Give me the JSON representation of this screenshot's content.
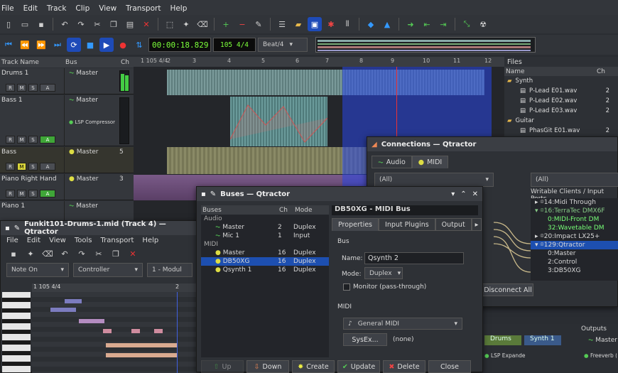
{
  "menu": [
    "File",
    "Edit",
    "Track",
    "Clip",
    "View",
    "Transport",
    "Help"
  ],
  "transport": {
    "time": "00:00:18.829",
    "tempo": "105 4/4",
    "snap": "Beat/4"
  },
  "tracklist": {
    "headers": {
      "name": "Track Name",
      "bus": "Bus",
      "ch": "Ch"
    },
    "tracks": [
      {
        "name": "Drums 1",
        "bus": "Master",
        "ch": ""
      },
      {
        "name": "Bass 1",
        "bus": "Master",
        "ch": "",
        "plugin": "LSP Compressor"
      },
      {
        "name": "Bass",
        "bus": "Master",
        "ch": "5"
      },
      {
        "name": "Piano Right Hand",
        "bus": "Master",
        "ch": "3"
      },
      {
        "name": "Piano 1",
        "bus": "Master",
        "ch": ""
      }
    ],
    "buttons": {
      "r": "R",
      "m": "M",
      "s": "S",
      "a": "A"
    }
  },
  "ruler": {
    "marks": [
      "1 105 4/4",
      "2",
      "3",
      "4",
      "5",
      "6",
      "7",
      "8",
      "9",
      "10",
      "11",
      "12"
    ]
  },
  "files": {
    "title": "Files",
    "headers": {
      "name": "Name",
      "ch": "Ch"
    },
    "items": [
      {
        "name": "Synth",
        "folder": true
      },
      {
        "name": "P-Lead E01.wav",
        "ch": "2"
      },
      {
        "name": "P-Lead E02.wav",
        "ch": "2"
      },
      {
        "name": "P-Lead E03.wav",
        "ch": "2"
      },
      {
        "name": "Guitar",
        "folder": true
      },
      {
        "name": "PhasGit E01.wav",
        "ch": "2"
      }
    ]
  },
  "connections": {
    "title": "Connections — Qtractor",
    "tab_audio": "Audio",
    "tab_midi": "MIDI",
    "filter_left": "(All)",
    "filter_right": "(All)",
    "writable_label": "Writable Clients / Input Ports",
    "clients": [
      {
        "label": "14:Midi Through"
      },
      {
        "label": "16:TerraTec DMX6F"
      },
      {
        "label": "0:MIDI-Front DM"
      },
      {
        "label": "32:Wavetable DM"
      },
      {
        "label": "20:Impact LX25+"
      },
      {
        "label": "129:Qtractor"
      },
      {
        "label": "0:Master"
      },
      {
        "label": "2:Control"
      },
      {
        "label": "3:DB50XG"
      }
    ],
    "disconnect_all": "Disconnect All"
  },
  "buses": {
    "title": "Buses — Qtractor",
    "headers": {
      "buses": "Buses",
      "ch": "Ch",
      "mode": "Mode"
    },
    "groups": [
      {
        "label": "Audio",
        "items": [
          {
            "name": "Master",
            "ch": "2",
            "mode": "Duplex"
          },
          {
            "name": "Mic 1",
            "ch": "1",
            "mode": "Input"
          }
        ]
      },
      {
        "label": "MIDI",
        "items": [
          {
            "name": "Master",
            "ch": "16",
            "mode": "Duplex"
          },
          {
            "name": "DB50XG",
            "ch": "16",
            "mode": "Duplex"
          },
          {
            "name": "Qsynth 1",
            "ch": "16",
            "mode": "Duplex"
          }
        ]
      }
    ],
    "panel_title": "DB50XG - MIDI Bus",
    "tabs": [
      "Properties",
      "Input Plugins",
      "Output"
    ],
    "bus_label": "Bus",
    "name_label": "Name:",
    "name_value": "Qsynth 2",
    "mode_label": "Mode:",
    "mode_value": "Duplex",
    "monitor_label": "Monitor (pass-through)",
    "midi_label": "MIDI",
    "instrument": "General MIDI",
    "sysex_label": "SysEx...",
    "sysex_value": "(none)",
    "footer": [
      "Up",
      "Down",
      "Create",
      "Update",
      "Delete",
      "Close"
    ]
  },
  "editor": {
    "title": "Funkit101-Drums-1.mid (Track 4) — Qtractor",
    "menu": [
      "File",
      "Edit",
      "View",
      "Tools",
      "Transport",
      "Help"
    ],
    "event_type": "Note On",
    "controller": "Controller",
    "module": "1 - Modul",
    "ruler": [
      "1 105 4/4",
      "2"
    ]
  },
  "mixer": {
    "strips": [
      "Drums",
      "Synth 1"
    ],
    "outputs_label": "Outputs",
    "output_name": "Master",
    "plugin": "LSP Expande",
    "plugin2": "Freeverb (Ver"
  }
}
